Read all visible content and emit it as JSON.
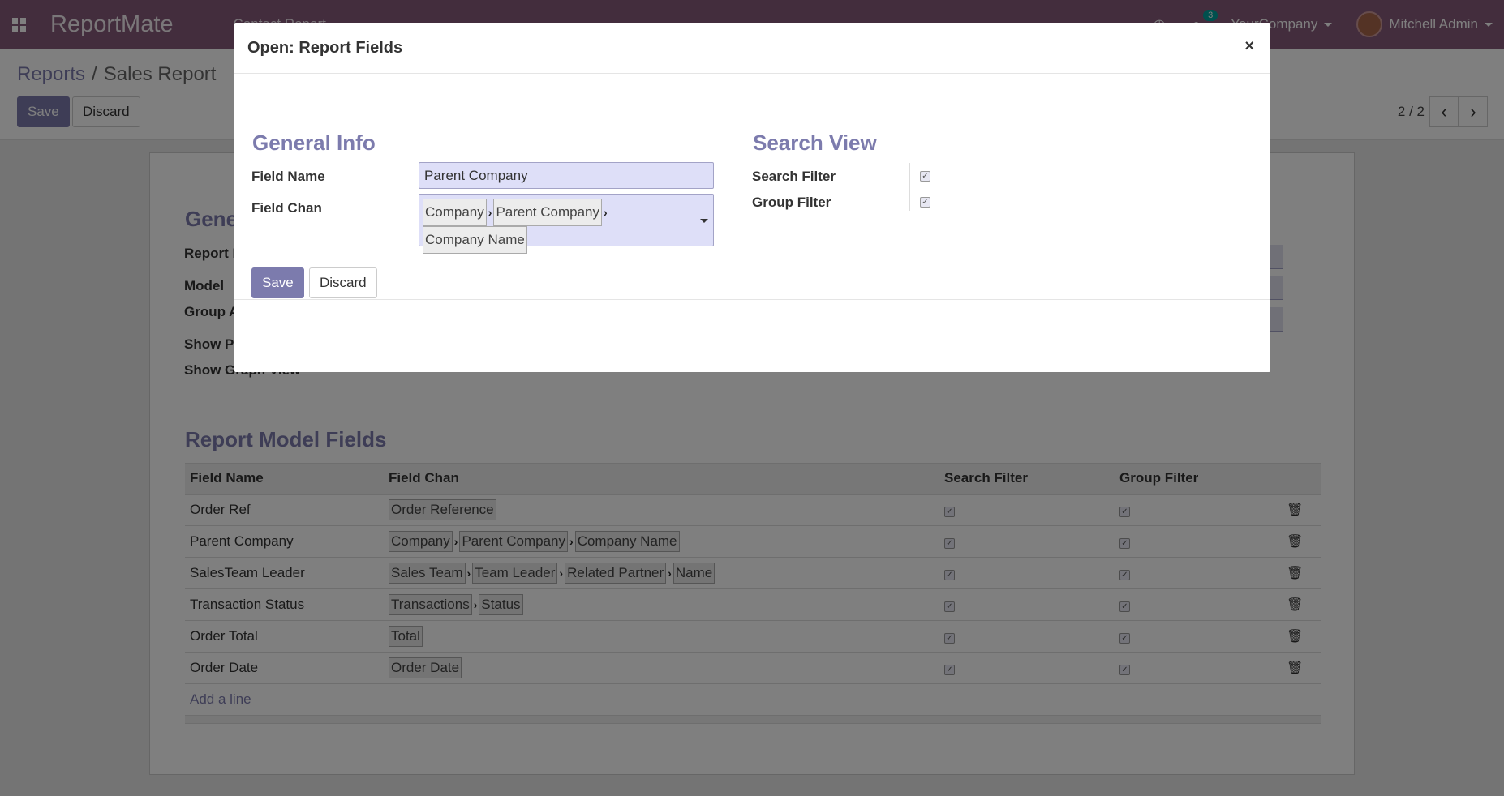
{
  "navbar": {
    "brand": "ReportMate",
    "menu": "Contact Report",
    "company": "YourCompany",
    "user": "Mitchell Admin",
    "message_count": "3",
    "accent": "#875a7b"
  },
  "breadcrumb": {
    "parent": "Reports",
    "sep": "/",
    "current": "Sales Report"
  },
  "control_panel": {
    "save_label": "Save",
    "discard_label": "Discard",
    "pager": "2 / 2"
  },
  "sheet": {
    "heading": "Gene",
    "labels": [
      "Report I",
      "Model",
      "Group A",
      "Show Pi",
      "Show Graph View"
    ],
    "fields_heading": "Report Model Fields",
    "columns": [
      "Field Name",
      "Field Chan",
      "Search Filter",
      "Group Filter"
    ],
    "rows": [
      {
        "name": "Order Ref",
        "chain": [
          "Order Reference"
        ]
      },
      {
        "name": "Parent Company",
        "chain": [
          "Company",
          "Parent Company",
          "Company Name"
        ]
      },
      {
        "name": "SalesTeam Leader",
        "chain": [
          "Sales Team",
          "Team Leader",
          "Related Partner",
          "Name"
        ]
      },
      {
        "name": "Transaction Status",
        "chain": [
          "Transactions",
          "Status"
        ]
      },
      {
        "name": "Order Total",
        "chain": [
          "Total"
        ]
      },
      {
        "name": "Order Date",
        "chain": [
          "Order Date"
        ]
      }
    ],
    "add_line": "Add a line"
  },
  "modal": {
    "title": "Open: Report Fields",
    "close": "×",
    "general_heading": "General Info",
    "search_heading": "Search View",
    "field_name_label": "Field Name",
    "field_name_value": "Parent Company",
    "field_chan_label": "Field Chan",
    "field_chan_tags": [
      "Company",
      "Parent Company",
      "Company Name"
    ],
    "search_filter_label": "Search Filter",
    "search_filter_checked": true,
    "group_filter_label": "Group Filter",
    "group_filter_checked": true,
    "save_label": "Save",
    "discard_label": "Discard"
  }
}
